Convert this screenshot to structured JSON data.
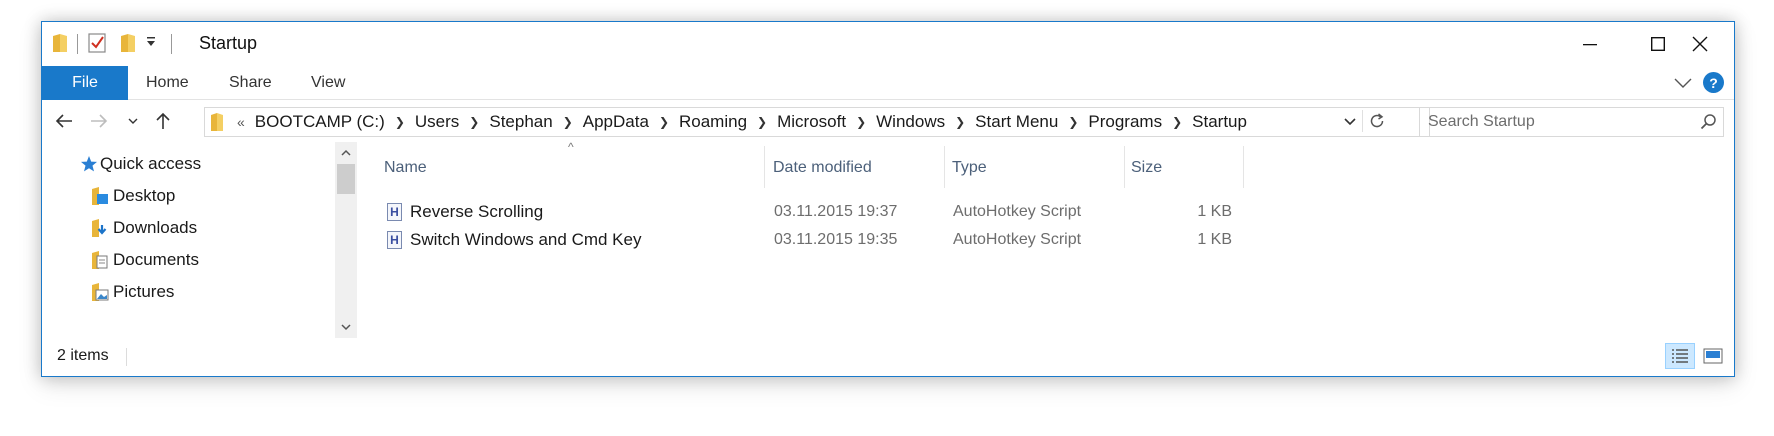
{
  "title_bar": {
    "title": "Startup",
    "quick_access_toolbar": [
      "folder-icon",
      "properties-icon",
      "new-folder-icon",
      "customize-dropdown-icon"
    ],
    "controls": [
      "minimize-icon",
      "maximize-icon",
      "close-icon"
    ]
  },
  "ribbon": {
    "file_tab": "File",
    "tabs": [
      "Home",
      "Share",
      "View"
    ],
    "help_label": "?"
  },
  "nav": {
    "overflow": "«",
    "breadcrumb": [
      "BOOTCAMP (C:)",
      "Users",
      "Stephan",
      "AppData",
      "Roaming",
      "Microsoft",
      "Windows",
      "Start Menu",
      "Programs",
      "Startup"
    ],
    "search_placeholder": "Search Startup"
  },
  "nav_pane": {
    "quick_access": "Quick access",
    "items": [
      {
        "label": "Desktop",
        "icon": "desktop-folder-icon",
        "pinned": true
      },
      {
        "label": "Downloads",
        "icon": "downloads-folder-icon",
        "pinned": true
      },
      {
        "label": "Documents",
        "icon": "documents-folder-icon",
        "pinned": true
      },
      {
        "label": "Pictures",
        "icon": "pictures-folder-icon",
        "pinned": true
      }
    ]
  },
  "file_list": {
    "columns": [
      "Name",
      "Date modified",
      "Type",
      "Size"
    ],
    "sort_indicator": "^",
    "rows": [
      {
        "name": "Reverse Scrolling",
        "date": "03.11.2015 19:37",
        "type": "AutoHotkey Script",
        "size": "1 KB",
        "icon_letter": "H"
      },
      {
        "name": "Switch Windows and Cmd Key",
        "date": "03.11.2015 19:35",
        "type": "AutoHotkey Script",
        "size": "1 KB",
        "icon_letter": "H"
      }
    ]
  },
  "status_bar": {
    "item_count": "2 items",
    "views": [
      "details-view-icon",
      "large-icons-view-icon"
    ],
    "active_view": "details-view-icon"
  },
  "colors": {
    "accent": "#1979ca",
    "folder": "#e8b53a",
    "header_text": "#4c607a",
    "muted_text": "#6d6d6d",
    "selected_view_bg": "#cce8ff"
  }
}
